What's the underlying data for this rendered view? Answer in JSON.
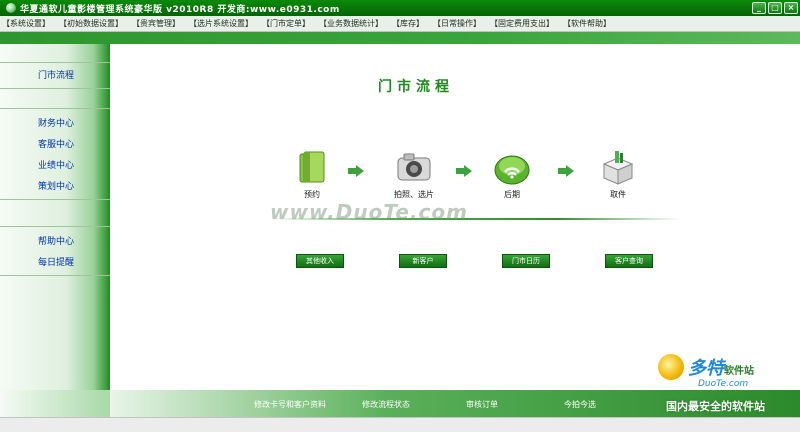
{
  "window": {
    "title": "华夏通软儿童影楼管理系统豪华版 v2010R8 开发商:www.e0931.com",
    "controls": [
      "_",
      "□",
      "×"
    ]
  },
  "menu": [
    "【系统设置】",
    "【初始数据设置】",
    "【贵宾管理】",
    "【选片系统设置】",
    "【门市定单】",
    "【业务数据统计】",
    "【库存】",
    "【日常操作】",
    "【固定费用支出】",
    "【软件帮助】"
  ],
  "sidebar": {
    "items": [
      "门市流程",
      "财务中心",
      "客服中心",
      "业绩中心",
      "策划中心",
      "帮助中心",
      "每日提醒"
    ]
  },
  "main": {
    "title": "门市流程",
    "steps": [
      {
        "label": "预约",
        "icon": "folder-icon"
      },
      {
        "label": "拍照、选片",
        "icon": "camera-icon"
      },
      {
        "label": "后期",
        "icon": "process-icon"
      },
      {
        "label": "取件",
        "icon": "box-icon"
      }
    ],
    "watermark": "www.DuoTe.com",
    "quick_buttons": [
      "其他收入",
      "新客户",
      "门市日历",
      "客户查询"
    ]
  },
  "footer": {
    "items": [
      "修改卡号和客户资料",
      "修改流程状态",
      "审核订单",
      "今拍今选"
    ]
  },
  "badge": {
    "title": "多特",
    "subtitle": "软件站",
    "url": "DuoTe.com",
    "slogan": "国内最安全的软件站"
  },
  "colors": {
    "accent": "#1f8a1f",
    "titlebar": "#056305",
    "sidebar_text": "#0033aa"
  }
}
